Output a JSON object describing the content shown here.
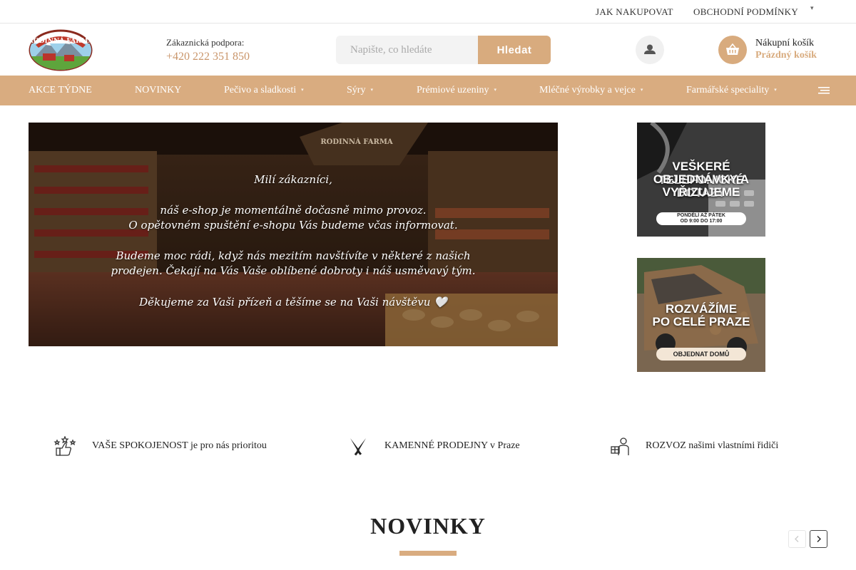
{
  "topbar": {
    "links": [
      "JAK NAKUPOVAT",
      "OBCHODNÍ PODMÍNKY"
    ],
    "extra_icon": "caret-icon"
  },
  "header": {
    "logo_text": "RODINNÁ FARMA",
    "support_label": "Zákaznická podpora:",
    "support_phone": "+420 222 351 850",
    "search_placeholder": "Napište, co hledáte",
    "search_button": "Hledat",
    "account_icon": "user-icon",
    "cart_icon": "basket-icon",
    "cart_title": "Nákupní košík",
    "cart_status": "Prázdný košík"
  },
  "nav": {
    "items": [
      {
        "label": "AKCE TÝDNE",
        "has_dropdown": false
      },
      {
        "label": "NOVINKY",
        "has_dropdown": false
      },
      {
        "label": "Pečivo a sladkosti",
        "has_dropdown": true
      },
      {
        "label": "Sýry",
        "has_dropdown": true
      },
      {
        "label": "Prémiové uzeniny",
        "has_dropdown": true
      },
      {
        "label": "Mléčné výrobky a vejce",
        "has_dropdown": true
      },
      {
        "label": "Farmářské speciality",
        "has_dropdown": true
      }
    ],
    "menu_icon": "hamburger-icon",
    "caret": "▾"
  },
  "hero": {
    "sign": "RODINNÁ FARMA",
    "lines": [
      "Milí zákazníci,",
      "náš e-shop je momentálně dočasně mimo provoz.",
      "O opětovném spuštění e-shopu Vás budeme včas informovat.",
      "Budeme moc rádi, když nás mezitím navštívíte v některé z našich",
      "prodejen. Čekají na Vás Vaše oblíbené dobroty i náš usměvavý tým.",
      "Děkujeme za Vaši přízeň a těšíme se na Vaši návštěvu 🤍"
    ]
  },
  "banners": [
    {
      "headline_lines": [
        "VEŠKERÉ TELEFONICKÉ",
        "OBJEDNÁVKY A DOTAZY",
        "VYŘIZUJEME"
      ],
      "pill_lines": [
        "PONDĚLÍ AŽ PÁTEK",
        "OD 9:00 DO 17:00"
      ]
    },
    {
      "headline_lines": [
        "ROZVÁŽÍME",
        "PO CELÉ PRAZE"
      ],
      "pill_lines": [
        "OBJEDNAT DOMŮ"
      ]
    }
  ],
  "features": [
    {
      "icon": "thumbs-up-stars-icon",
      "label": "VAŠE SPOKOJENOST je pro nás prioritou"
    },
    {
      "icon": "crossed-knives-icon",
      "label": "KAMENNÉ PRODEJNY v Praze"
    },
    {
      "icon": "delivery-person-icon",
      "label": "ROZVOZ našimi vlastními řidiči"
    }
  ],
  "section": {
    "title": "NOVINKY",
    "prev_icon": "chevron-left-icon",
    "next_icon": "chevron-right-icon"
  },
  "colors": {
    "accent": "#d9ac80",
    "accent_text": "#c9956a"
  }
}
